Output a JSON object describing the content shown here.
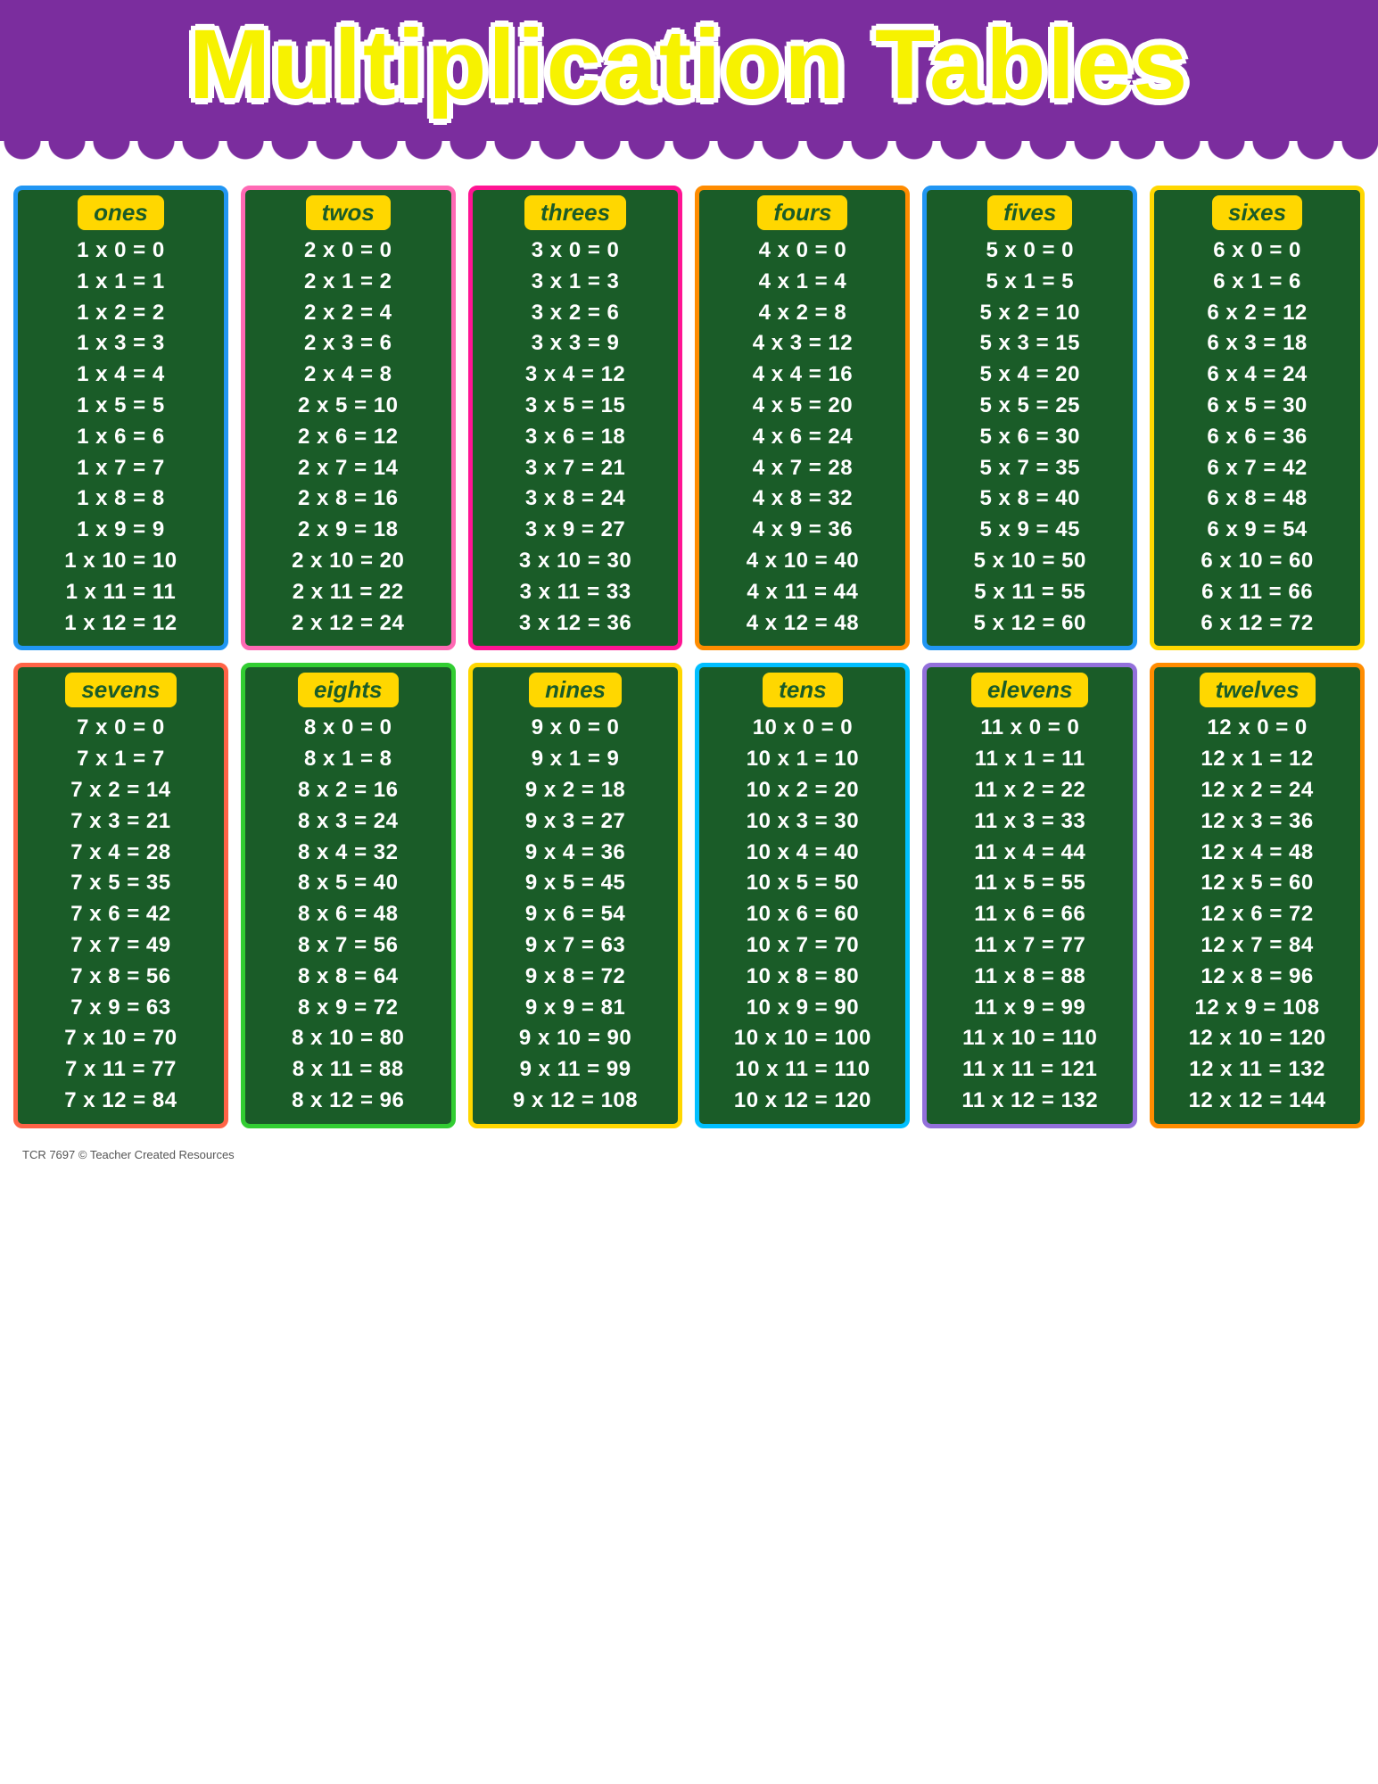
{
  "header": {
    "title": "Multiplication Tables"
  },
  "tables": [
    {
      "id": "ones",
      "label": "ones",
      "cardClass": "card-ones",
      "rows": [
        "1 x 0 = 0",
        "1 x 1 = 1",
        "1 x 2 = 2",
        "1 x 3 = 3",
        "1 x 4 = 4",
        "1 x 5 = 5",
        "1 x 6 = 6",
        "1 x 7 = 7",
        "1 x 8 = 8",
        "1 x 9 = 9",
        "1 x 10 = 10",
        "1 x 11 = 11",
        "1 x 12 = 12"
      ]
    },
    {
      "id": "twos",
      "label": "twos",
      "cardClass": "card-twos",
      "rows": [
        "2 x 0 = 0",
        "2 x 1 = 2",
        "2 x 2 = 4",
        "2 x 3 = 6",
        "2 x 4 = 8",
        "2 x 5 = 10",
        "2 x 6 = 12",
        "2 x 7 = 14",
        "2 x 8 = 16",
        "2 x 9 = 18",
        "2 x 10 = 20",
        "2 x 11 = 22",
        "2 x 12 = 24"
      ]
    },
    {
      "id": "threes",
      "label": "threes",
      "cardClass": "card-threes",
      "rows": [
        "3 x 0 = 0",
        "3 x 1 = 3",
        "3 x 2 = 6",
        "3 x 3 = 9",
        "3 x 4 = 12",
        "3 x 5 = 15",
        "3 x 6 = 18",
        "3 x 7 = 21",
        "3 x 8 = 24",
        "3 x 9 = 27",
        "3 x 10 = 30",
        "3 x 11 = 33",
        "3 x 12 = 36"
      ]
    },
    {
      "id": "fours",
      "label": "fours",
      "cardClass": "card-fours",
      "rows": [
        "4 x 0 = 0",
        "4 x 1 = 4",
        "4 x 2 = 8",
        "4 x 3 = 12",
        "4 x 4 = 16",
        "4 x 5 = 20",
        "4 x 6 = 24",
        "4 x 7 = 28",
        "4 x 8 = 32",
        "4 x 9 = 36",
        "4 x 10 = 40",
        "4 x 11 = 44",
        "4 x 12 = 48"
      ]
    },
    {
      "id": "fives",
      "label": "fives",
      "cardClass": "card-fives",
      "rows": [
        "5 x 0 = 0",
        "5 x 1 = 5",
        "5 x 2 = 10",
        "5 x 3 = 15",
        "5 x 4 = 20",
        "5 x 5 = 25",
        "5 x 6 = 30",
        "5 x 7 = 35",
        "5 x 8 = 40",
        "5 x 9 = 45",
        "5 x 10 = 50",
        "5 x 11 = 55",
        "5 x 12 = 60"
      ]
    },
    {
      "id": "sixes",
      "label": "sixes",
      "cardClass": "card-sixes",
      "rows": [
        "6 x 0 = 0",
        "6 x 1 = 6",
        "6 x 2 = 12",
        "6 x 3 = 18",
        "6 x 4 = 24",
        "6 x 5 = 30",
        "6 x 6 = 36",
        "6 x 7 = 42",
        "6 x 8 = 48",
        "6 x 9 = 54",
        "6 x 10 = 60",
        "6 x 11 = 66",
        "6 x 12 = 72"
      ]
    },
    {
      "id": "sevens",
      "label": "sevens",
      "cardClass": "card-sevens",
      "rows": [
        "7 x 0 = 0",
        "7 x 1 = 7",
        "7 x 2 = 14",
        "7 x 3 = 21",
        "7 x 4 = 28",
        "7 x 5 = 35",
        "7 x 6 = 42",
        "7 x 7 = 49",
        "7 x 8 = 56",
        "7 x 9 = 63",
        "7 x 10 = 70",
        "7 x 11 = 77",
        "7 x 12 = 84"
      ]
    },
    {
      "id": "eights",
      "label": "eights",
      "cardClass": "card-eights",
      "rows": [
        "8 x 0 = 0",
        "8 x 1 = 8",
        "8 x 2 = 16",
        "8 x 3 = 24",
        "8 x 4 = 32",
        "8 x 5 = 40",
        "8 x 6 = 48",
        "8 x 7 = 56",
        "8 x 8 = 64",
        "8 x 9 = 72",
        "8 x 10 = 80",
        "8 x 11 = 88",
        "8 x 12 = 96"
      ]
    },
    {
      "id": "nines",
      "label": "nines",
      "cardClass": "card-nines",
      "rows": [
        "9 x 0 = 0",
        "9 x 1 = 9",
        "9 x 2 = 18",
        "9 x 3 = 27",
        "9 x 4 = 36",
        "9 x 5 = 45",
        "9 x 6 = 54",
        "9 x 7 = 63",
        "9 x 8 = 72",
        "9 x 9 = 81",
        "9 x 10 = 90",
        "9 x 11 = 99",
        "9 x 12 = 108"
      ]
    },
    {
      "id": "tens",
      "label": "tens",
      "cardClass": "card-tens",
      "rows": [
        "10 x 0 = 0",
        "10 x 1 = 10",
        "10 x 2 = 20",
        "10 x 3 = 30",
        "10 x 4 = 40",
        "10 x 5 = 50",
        "10 x 6 = 60",
        "10 x 7 = 70",
        "10 x 8 = 80",
        "10 x 9 = 90",
        "10 x 10 = 100",
        "10 x 11 = 110",
        "10 x 12 = 120"
      ]
    },
    {
      "id": "elevens",
      "label": "elevens",
      "cardClass": "card-elevens",
      "rows": [
        "11 x 0 = 0",
        "11 x 1 = 11",
        "11 x 2 = 22",
        "11 x 3 = 33",
        "11 x 4 = 44",
        "11 x 5 = 55",
        "11 x 6 = 66",
        "11 x 7 = 77",
        "11 x 8 = 88",
        "11 x 9 = 99",
        "11 x 10 = 110",
        "11 x 11 = 121",
        "11 x 12 = 132"
      ]
    },
    {
      "id": "twelves",
      "label": "twelves",
      "cardClass": "card-twelves",
      "rows": [
        "12 x 0 = 0",
        "12 x 1 = 12",
        "12 x 2 = 24",
        "12 x 3 = 36",
        "12 x 4 = 48",
        "12 x 5 = 60",
        "12 x 6 = 72",
        "12 x 7 = 84",
        "12 x 8 = 96",
        "12 x 9 = 108",
        "12 x 10 = 120",
        "12 x 11 = 132",
        "12 x 12 = 144"
      ]
    }
  ],
  "footer": "TCR 7697  © Teacher Created Resources"
}
